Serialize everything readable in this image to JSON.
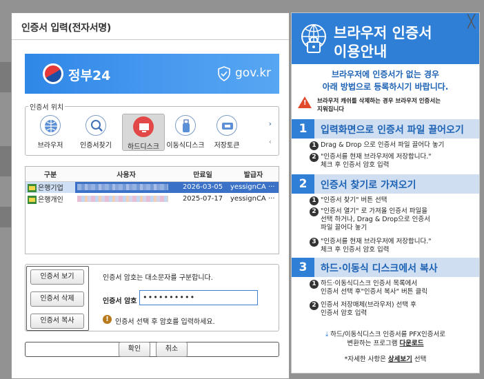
{
  "dialog": {
    "title": "인증서 입력(전자서명)",
    "banner": {
      "gov_name": "정부24",
      "domain": "gov.kr",
      "brand_color": "#2f87e6"
    },
    "location": {
      "legend": "인증서 위치",
      "items": [
        {
          "label": "브라우저",
          "icon": "globe-icon"
        },
        {
          "label": "인증서찾기",
          "icon": "magnifier-icon"
        },
        {
          "label": "하드디스크",
          "icon": "monitor-icon"
        },
        {
          "label": "이동식디스크",
          "icon": "usb-icon"
        },
        {
          "label": "저장토큰",
          "icon": "token-icon"
        }
      ],
      "selected": "하드디스크"
    },
    "table": {
      "headers": [
        "구분",
        "사용자",
        "만료일",
        "발급자"
      ],
      "rows": [
        {
          "type": "은행기업",
          "expires": "2026-03-05",
          "issuer": "yessignCA ···",
          "selected": true
        },
        {
          "type": "은행개인",
          "expires": "2025-07-17",
          "issuer": "yessignCA ···",
          "selected": false
        }
      ]
    },
    "actions": {
      "view": "인증서 보기",
      "delete": "인증서 삭제",
      "copy": "인증서 복사",
      "case_note": "인증서 암호는 대소문자를 구분합니다.",
      "password_label": "인증서 암호",
      "password_value": "••••••••••",
      "hint": "인증서 선택 후 암호를 입력하세요."
    },
    "confirm": "확인",
    "cancel": "취소"
  },
  "guide": {
    "title_line1": "브라우저 인증서",
    "title_line2": "이용안내",
    "close": "╳",
    "intro_line1": "브라우저에 인증서가 없는 경우",
    "intro_line2": "아래 방법으로 등록하시기 바랍니다.",
    "warn_line1": "브라우저 캐쉬를 삭제하는 경우 브라우저 인증서는",
    "warn_line2": "지워집니다",
    "steps": [
      {
        "num": "1",
        "title": "입력화면으로 인증서 파일 끌어오기",
        "items": [
          {
            "n": "1",
            "lines": [
              "Drag & Drop 으로 인증서 파일 끌어다 놓기"
            ]
          },
          {
            "n": "2",
            "lines": [
              "\"인증서를 현재 브라우저에 저장합니다.\"",
              "체크 후 인증서 암호 입력"
            ]
          }
        ]
      },
      {
        "num": "2",
        "title": "인증서 찾기로 가져오기",
        "items": [
          {
            "n": "1",
            "lines": [
              "\"인증서 찾기\" 버튼 선택"
            ]
          },
          {
            "n": "2",
            "lines": [
              "\"인증서 열기\" 로 가져올 인증서 파일을",
              "선택 하거나, Drag & Drop으로 인증서",
              "파일 끌어다 놓기"
            ]
          },
          {
            "n": "3",
            "lines": [
              "\"인증서를 현재 브라우저에 저장합니다.\"",
              "체크 후 인증서 암호 입력"
            ]
          }
        ]
      },
      {
        "num": "3",
        "title": "하드·이동식 디스크에서 복사",
        "items": [
          {
            "n": "1",
            "lines": [
              "하드·이동식디스크 인증서 목록에서",
              "인증서 선택 후\"인증서 복사\" 버튼 클릭"
            ]
          },
          {
            "n": "2",
            "lines": [
              "인증서 저장매체(브라우저) 선택 후",
              "인증서 암호 입력"
            ]
          }
        ]
      }
    ],
    "download_line1": "하드/이동식디스크 인증서를 PFX인증서로",
    "download_line2_pre": "변환하는 프로그램",
    "download_link": "다운로드",
    "detail_pre": "*자세한 사항은",
    "detail_link": "상세보기",
    "detail_post": "선택",
    "accent_color": "#2f7fd6"
  }
}
